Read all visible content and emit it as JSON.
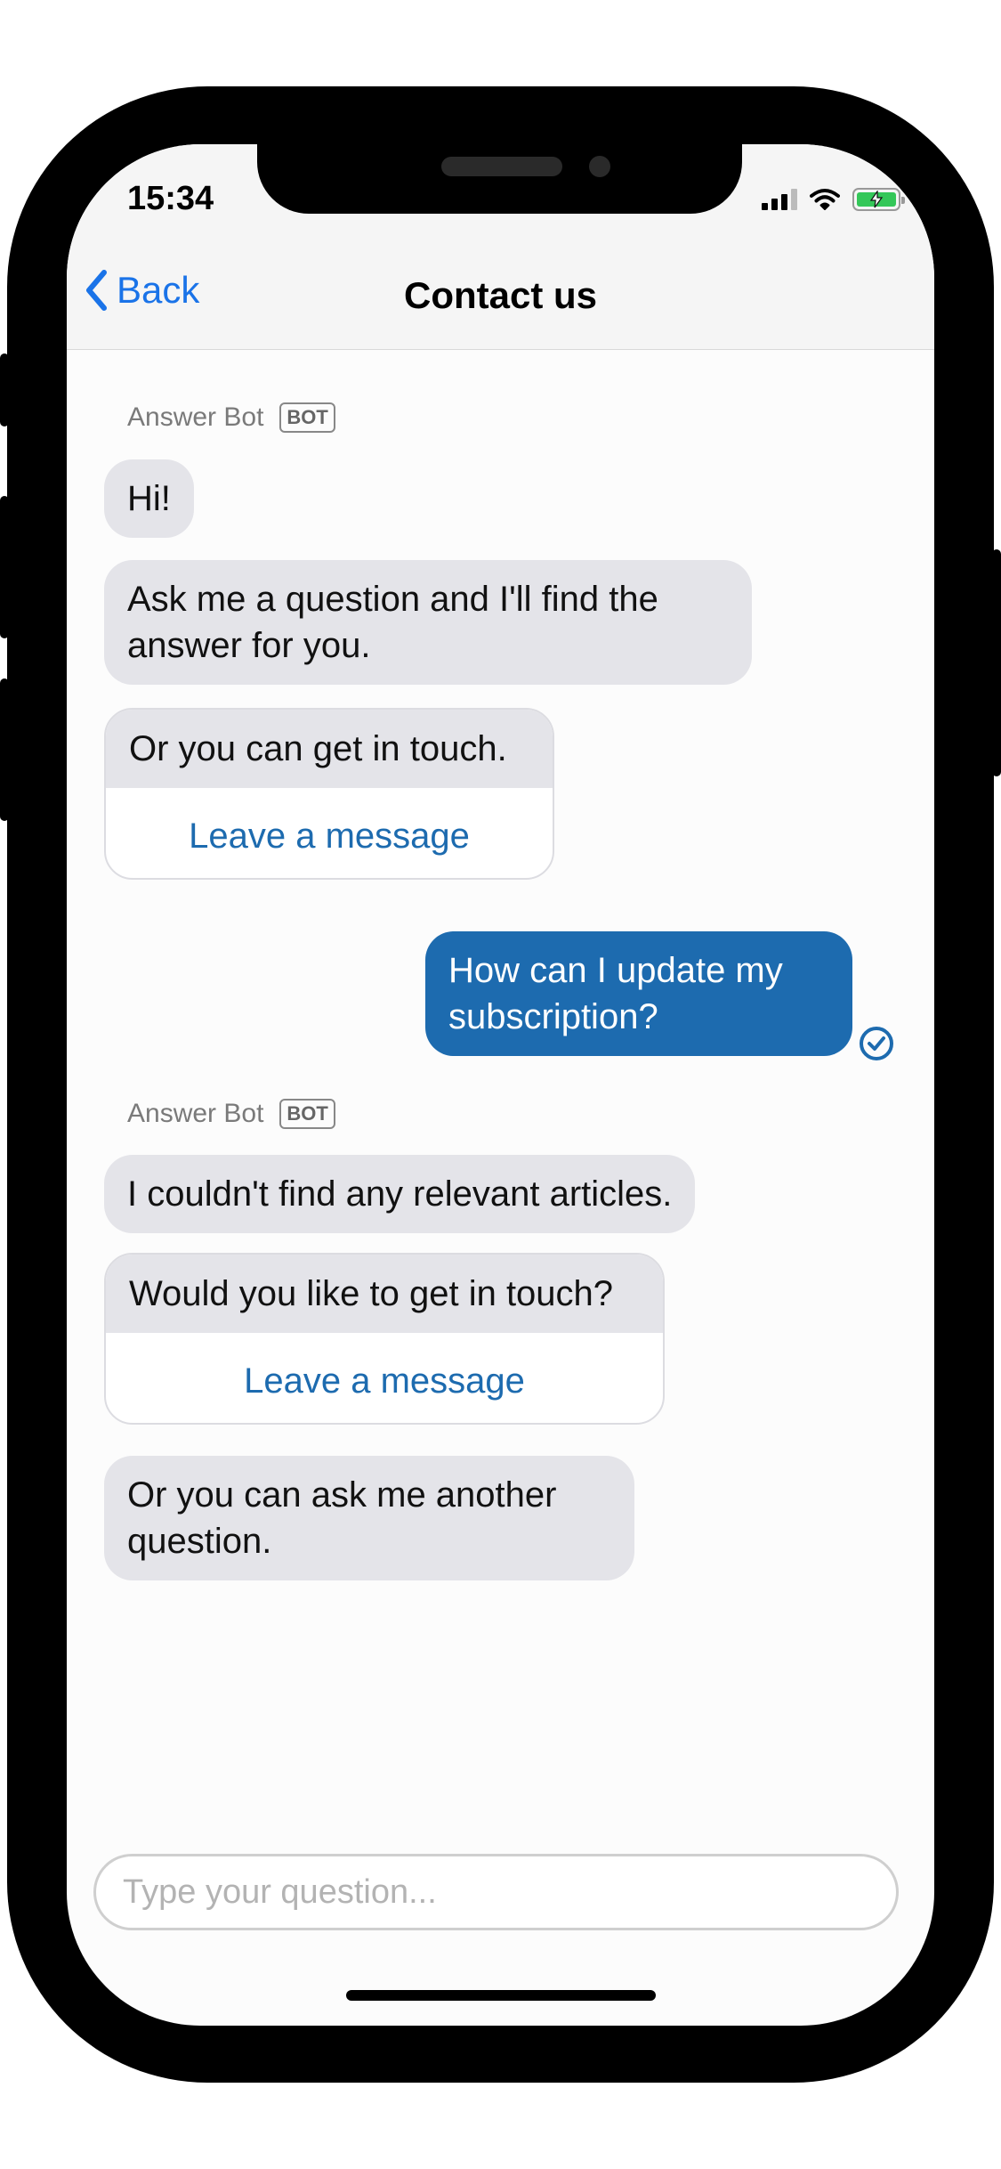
{
  "status_bar": {
    "time": "15:34"
  },
  "nav": {
    "back_label": "Back",
    "title": "Contact us"
  },
  "messages": {
    "group1": {
      "sender": "Answer Bot",
      "badge": "BOT",
      "m1": "Hi!",
      "m2": "Ask me a question and I'll find the answer for you.",
      "card_text": "Or you can get in touch.",
      "card_action": "Leave a message"
    },
    "user": {
      "text": "How can I update my subscription?"
    },
    "group2": {
      "sender": "Answer Bot",
      "badge": "BOT",
      "m1": "I couldn't find any relevant articles.",
      "card_text": "Would you like to get in touch?",
      "card_action": "Leave a message",
      "m2": "Or you can ask me another question."
    }
  },
  "composer": {
    "placeholder": "Type your question..."
  },
  "colors": {
    "accent": "#1a73e8",
    "user_bubble": "#1d6baf",
    "bot_bubble": "#e4e4e9",
    "battery": "#34c759"
  },
  "icons": {
    "back": "chevron-left-icon",
    "delivered": "check-circle-icon",
    "signal": "cellular-signal-icon",
    "wifi": "wifi-icon",
    "battery": "battery-charging-icon"
  }
}
